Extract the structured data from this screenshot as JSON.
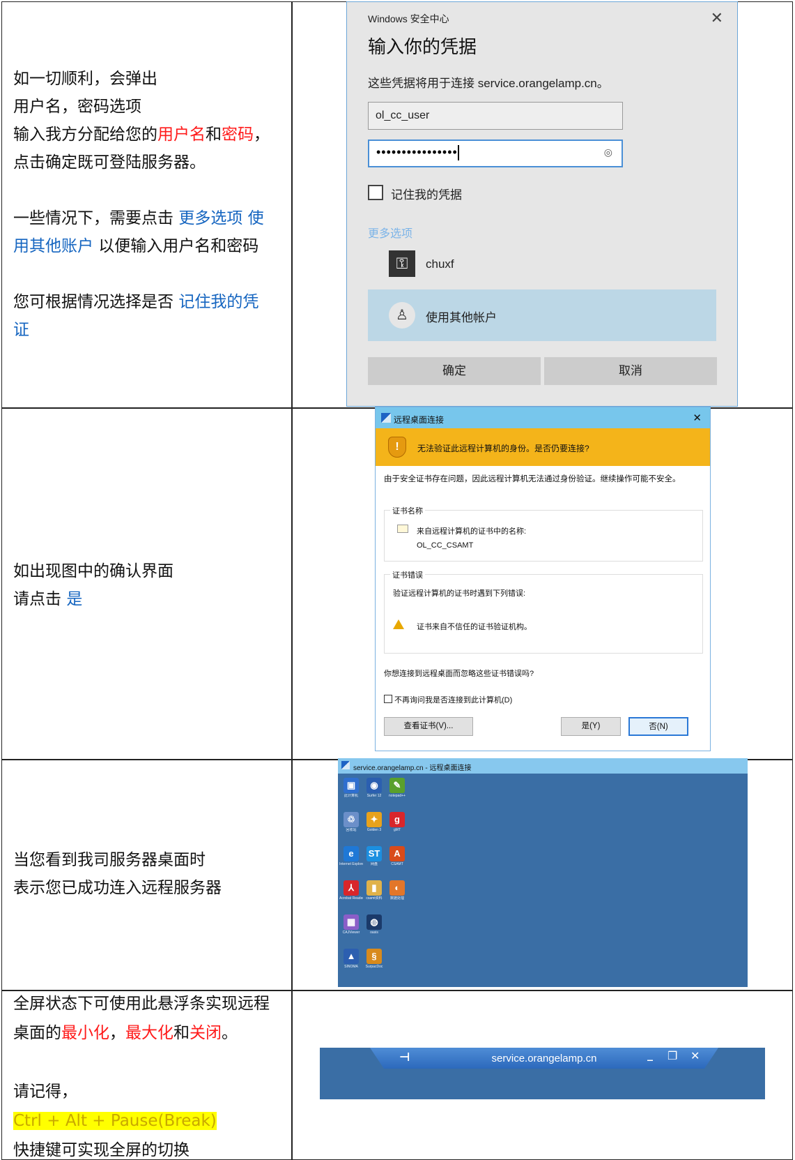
{
  "row1": {
    "text": {
      "line1": "如一切顺利，会弹出",
      "line2": "用户名，密码选项",
      "line3_a": "输入我方分配给您的",
      "line3_red1": "用户名",
      "line3_b": "和",
      "line3_red2": "密码",
      "line3_c": "，",
      "line4": "点击确定既可登陆服务器。",
      "line5_a": "一些情况下，需要点击 ",
      "line5_blue": "更多选项 使",
      "line6_blue": "用其他账户",
      "line6_b": " 以便输入用户名和密码",
      "line7_a": "您可根据情况选择是否 ",
      "line7_blue": "记住我的凭",
      "line8_blue": "证"
    },
    "dialog": {
      "window_title": "Windows 安全中心",
      "close_glyph": "✕",
      "heading": "输入你的凭据",
      "description": "这些凭据将用于连接 service.orangelamp.cn。",
      "username_value": "ol_cc_user",
      "password_mask": "••••••••••••••••",
      "eye_glyph": "◎",
      "remember_label": "记住我的凭据",
      "more_options": "更多选项",
      "account1_name": "chuxf",
      "account1_icon": "key-icon",
      "account1_glyph": "⚿",
      "account2_name": "使用其他帐户",
      "account2_icon": "user-icon",
      "account2_glyph": "♙",
      "ok_label": "确定",
      "cancel_label": "取消"
    }
  },
  "row2": {
    "text": {
      "line1": "如出现图中的确认界面",
      "line2_a": "请点击 ",
      "line2_blue": "是"
    },
    "dialog": {
      "window_title": "远程桌面连接",
      "close_glyph": "✕",
      "warning_glyph": "!",
      "warning_text": "无法验证此远程计算机的身份。是否仍要连接?",
      "body": "由于安全证书存在问题，因此远程计算机无法通过身份验证。继续操作可能不安全。",
      "cert_name_group": "证书名称",
      "cert_name_desc": "来自远程计算机的证书中的名称:",
      "cert_name_value": "OL_CC_CSAMT",
      "cert_error_group": "证书错误",
      "cert_error_desc": "验证远程计算机的证书时遇到下列错误:",
      "cert_error_item": "证书来自不信任的证书验证机构。",
      "question": "你想连接到远程桌面而忽略这些证书错误吗?",
      "dont_ask_label": "不再询问我是否连接到此计算机(D)",
      "view_cert_label": "查看证书(V)...",
      "yes_label": "是(Y)",
      "no_label": "否(N)"
    }
  },
  "row3": {
    "text": {
      "line1": "当您看到我司服务器桌面时",
      "line2": "表示您已成功连入远程服务器"
    },
    "desktop": {
      "window_title": "service.orangelamp.cn - 远程桌面连接",
      "icons": [
        {
          "glyph": "▣",
          "label": "此计算机",
          "color": "#2f6fcf"
        },
        {
          "glyph": "◉",
          "label": "Surfer 12",
          "color": "#2b5fb0"
        },
        {
          "glyph": "✎",
          "label": "notepad++",
          "color": "#5aa02c"
        },
        {
          "glyph": "♲",
          "label": "回收站",
          "color": "#6b8fc9"
        },
        {
          "glyph": "✦",
          "label": "Golden 3",
          "color": "#e8a21c"
        },
        {
          "glyph": "g",
          "label": "gMT",
          "color": "#d8262b"
        },
        {
          "glyph": "e",
          "label": "Internet Explorer",
          "color": "#1f78d6"
        },
        {
          "glyph": "ST",
          "label": "网盘",
          "color": "#1c8fe0"
        },
        {
          "glyph": "A",
          "label": "CSAMT",
          "color": "#d94b1a"
        },
        {
          "glyph": "⅄",
          "label": "Acrobat Reader DC",
          "color": "#d8262b"
        },
        {
          "glyph": "▮",
          "label": "csamt资料",
          "color": "#e0b24a"
        },
        {
          "glyph": "◐",
          "label": "数据处理",
          "color": "#e2762a"
        },
        {
          "glyph": "▦",
          "label": "CAJViewer",
          "color": "#8a5ec8"
        },
        {
          "glyph": "◍",
          "label": "oasis",
          "color": "#1b3a6a"
        },
        {
          "glyph": "▲",
          "label": "SINOMA",
          "color": "#2c5fb0"
        },
        {
          "glyph": "§",
          "label": "SurpacDoc",
          "color": "#d88a1c"
        }
      ]
    }
  },
  "row4": {
    "text": {
      "line1": "全屏状态下可使用此悬浮条实现远程",
      "line2_a": "桌面的",
      "line2_red1": "最小化",
      "line2_b": "，",
      "line2_red2": "最大化",
      "line2_c": "和",
      "line2_red3": "关闭",
      "line2_d": "。",
      "line3": "请记得，",
      "line4_hl": "Ctrl + Alt + Pause(Break)",
      "line5": "快捷键可实现全屏的切换"
    },
    "bar": {
      "pin_glyph": "⊣",
      "host": "service.orangelamp.cn",
      "min_glyph": "_",
      "max_glyph": "❐",
      "close_glyph": "✕"
    }
  }
}
